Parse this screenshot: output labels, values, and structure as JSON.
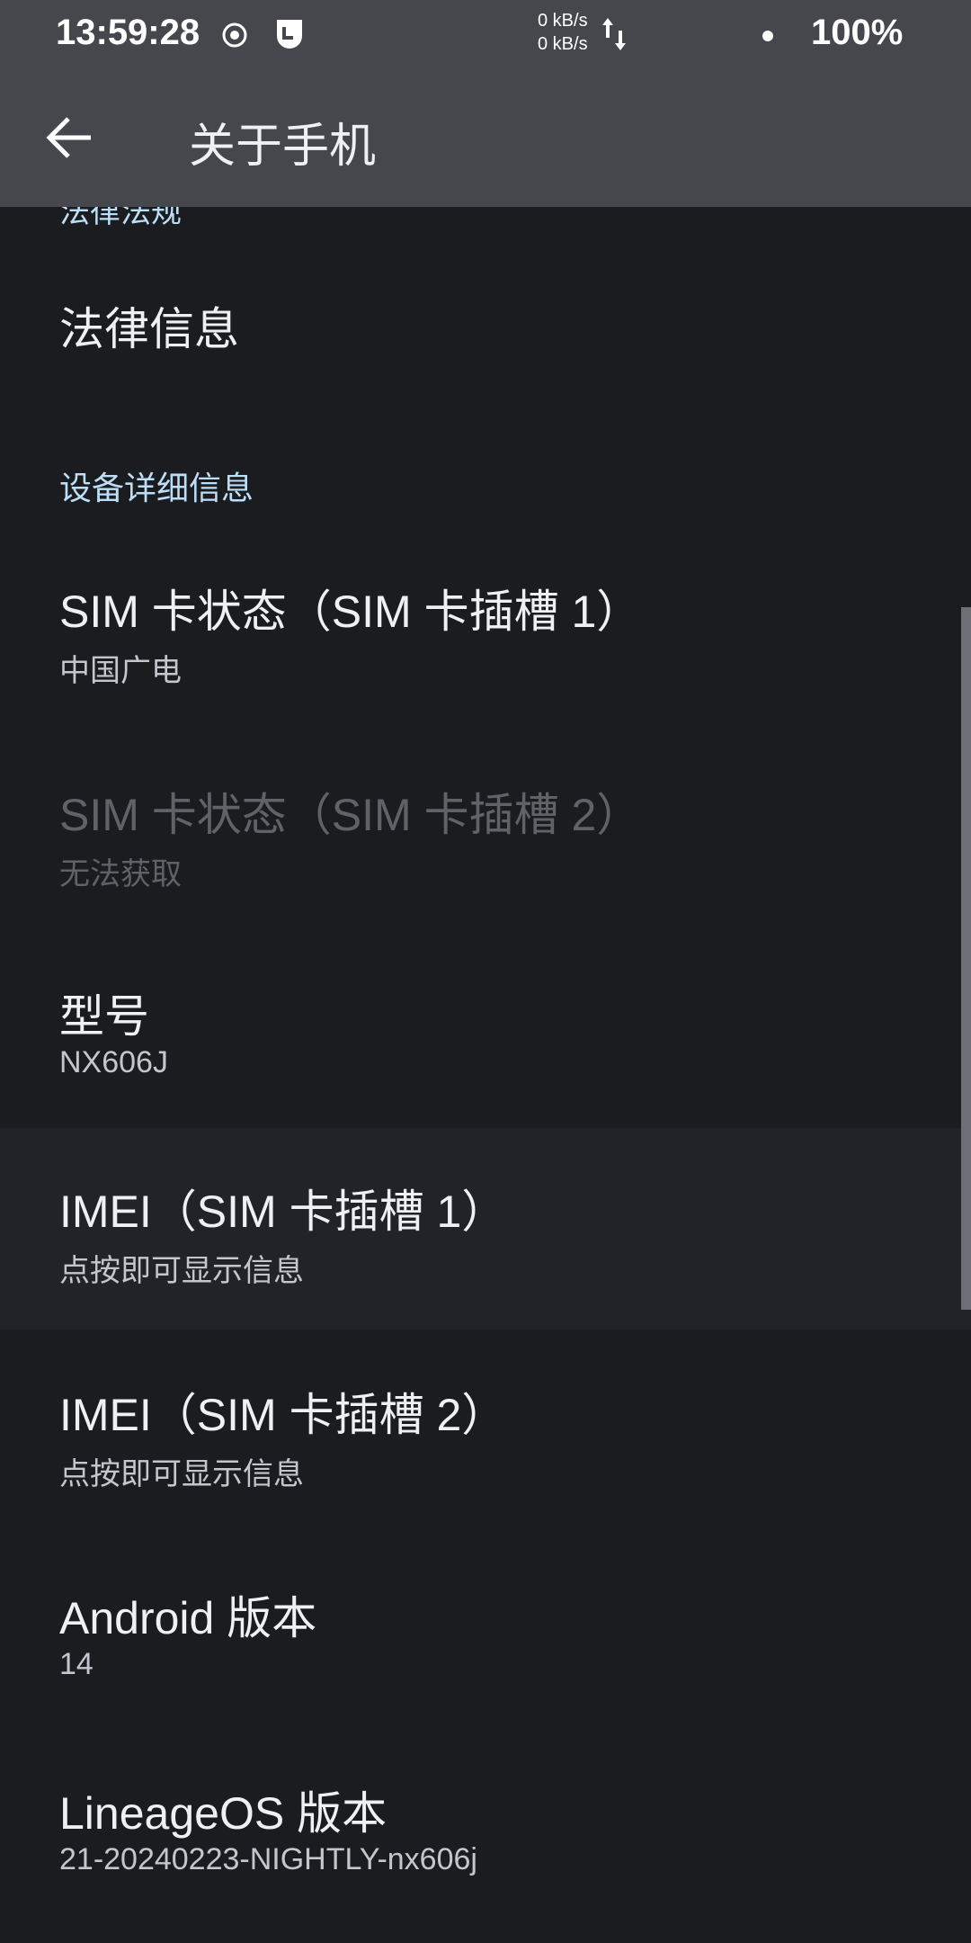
{
  "status_bar": {
    "time": "13:59:28",
    "upload_rate": "0 kB/s",
    "download_rate": "0 kB/s",
    "battery": "100%"
  },
  "app_bar": {
    "title": "关于手机"
  },
  "partial_header": "法律法规",
  "items_top": [
    {
      "title": "法律信息"
    }
  ],
  "section": "设备详细信息",
  "items": [
    {
      "title": "SIM 卡状态（SIM 卡插槽 1）",
      "summary": "中国广电"
    },
    {
      "title": "SIM 卡状态（SIM 卡插槽 2）",
      "summary": "无法获取"
    },
    {
      "title": "型号",
      "summary": "NX606J"
    },
    {
      "title": "IMEI（SIM 卡插槽 1）",
      "summary": "点按即可显示信息"
    },
    {
      "title": "IMEI（SIM 卡插槽 2）",
      "summary": "点按即可显示信息"
    },
    {
      "title": "Android 版本",
      "summary": "14"
    },
    {
      "title": "LineageOS 版本",
      "summary": "21-20240223-NIGHTLY-nx606j"
    }
  ]
}
